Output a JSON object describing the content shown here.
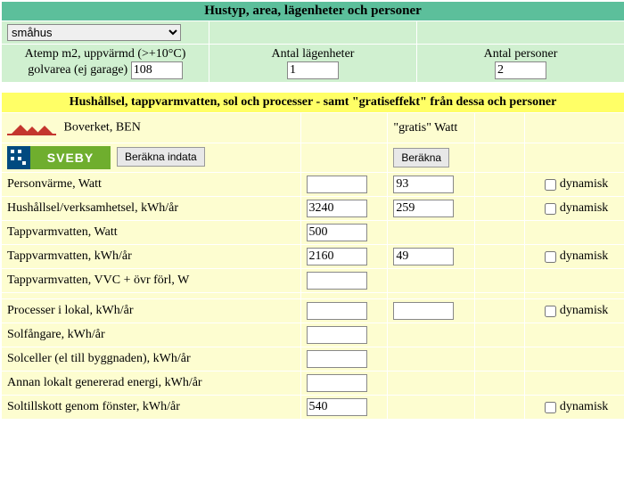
{
  "section1": {
    "title": "Hustyp, area, lägenheter och personer",
    "hustyp_selected": "småhus",
    "atemp_label_l1": "Atemp m2, uppvärmd (>+10°C)",
    "atemp_label_l2": "golvarea (ej garage)",
    "atemp_value": "108",
    "antal_lagenheter_label": "Antal lägenheter",
    "antal_lagenheter_value": "1",
    "antal_personer_label": "Antal personer",
    "antal_personer_value": "2"
  },
  "section2": {
    "title": "Hushållsel, tappvarmvatten, sol och processer - samt \"gratiseffekt\" från dessa och personer",
    "boverket_label": "Boverket, BEN",
    "sveby_label": "SVEBY",
    "berakna_indata_btn": "Beräkna indata",
    "gratis_watt_header": "\"gratis\" Watt",
    "berakna_btn": "Beräkna",
    "dynamisk_label": "dynamisk",
    "rows": [
      {
        "label": "Personvärme, Watt",
        "v1": "",
        "v2": "93",
        "dyn": true
      },
      {
        "label": "Hushållsel/verksamhetsel, kWh/år",
        "v1": "3240",
        "v2": "259",
        "dyn": true
      },
      {
        "label": "Tappvarmvatten, Watt",
        "v1": "500",
        "v2": null,
        "dyn": false
      },
      {
        "label": "Tappvarmvatten, kWh/år",
        "v1": "2160",
        "v2": "49",
        "dyn": true
      },
      {
        "label": "Tappvarmvatten, VVC + övr förl, W",
        "v1": "",
        "v2": null,
        "dyn": false
      },
      {
        "label": "",
        "v1": null,
        "v2": null,
        "dyn": false
      },
      {
        "label": "Processer i lokal, kWh/år",
        "v1": "",
        "v2": "",
        "dyn": true
      },
      {
        "label": "Solfångare, kWh/år",
        "v1": "",
        "v2": null,
        "dyn": false
      },
      {
        "label": "Solceller (el till byggnaden), kWh/år",
        "v1": "",
        "v2": null,
        "dyn": false
      },
      {
        "label": "Annan lokalt genererad energi, kWh/år",
        "v1": "",
        "v2": null,
        "dyn": false
      },
      {
        "label": "Soltillskott genom fönster, kWh/år",
        "v1": "540",
        "v2": null,
        "dyn": true
      }
    ]
  }
}
